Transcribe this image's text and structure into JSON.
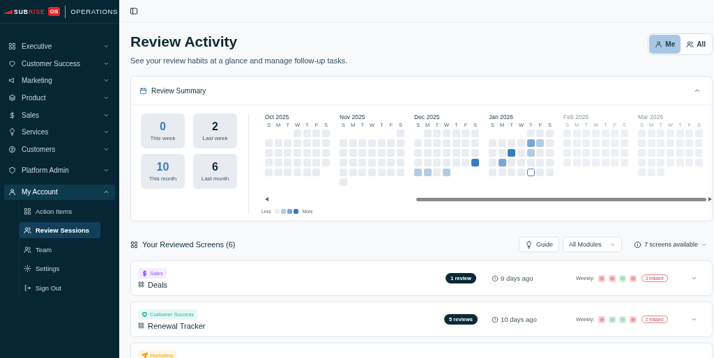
{
  "logo": {
    "lead": "SUB",
    "accent": "RISE",
    "badge": "OS",
    "product": "OPERATIONS"
  },
  "nav": [
    {
      "label": "Executive",
      "expanded": false
    },
    {
      "label": "Customer Success",
      "expanded": false
    },
    {
      "label": "Marketing",
      "expanded": false
    },
    {
      "label": "Product",
      "expanded": false
    },
    {
      "label": "Sales",
      "expanded": false
    },
    {
      "label": "Services",
      "expanded": false
    },
    {
      "label": "Customers",
      "expanded": false
    },
    {
      "label": "Platform Admin",
      "expanded": false
    },
    {
      "label": "My Account",
      "expanded": true,
      "children": [
        {
          "label": "Action Items",
          "selected": false
        },
        {
          "label": "Review Sessions",
          "selected": true
        },
        {
          "label": "Team",
          "selected": false
        },
        {
          "label": "Settings",
          "selected": false
        },
        {
          "label": "Sign Out",
          "selected": false
        }
      ]
    }
  ],
  "header": {
    "title": "Review Activity",
    "subtitle": "See your review habits at a glance and manage follow-up tasks."
  },
  "scope": [
    {
      "label": "Me",
      "selected": true
    },
    {
      "label": "All",
      "selected": false
    }
  ],
  "summary": {
    "title": "Review Summary",
    "expanded": true,
    "stats": [
      {
        "value": "0",
        "label": "This week",
        "highlight": true
      },
      {
        "value": "2",
        "label": "Last week",
        "highlight": false
      },
      {
        "value": "10",
        "label": "This month",
        "highlight": true
      },
      {
        "value": "6",
        "label": "Last month",
        "highlight": false
      }
    ],
    "months": [
      {
        "label": "Oct 2025",
        "faded": false,
        "weekdays": [
          "S",
          "M",
          "T",
          "W",
          "T",
          "F",
          "S"
        ],
        "weeks": [
          [
            {
              "kind": "none",
              "today": false
            },
            {
              "kind": "none",
              "today": false
            },
            {
              "kind": "none",
              "today": false
            },
            {
              "kind": "none",
              "today": false
            }
          ],
          [
            {
              "kind": "none",
              "today": false
            },
            {
              "kind": "none",
              "today": false
            },
            {
              "kind": "none",
              "today": false
            },
            {
              "kind": "none",
              "today": false
            },
            {
              "kind": "none",
              "today": false
            },
            {
              "kind": "none",
              "today": false
            },
            {
              "kind": "none",
              "today": false
            }
          ],
          [
            {
              "kind": "none",
              "today": false
            },
            {
              "kind": "none",
              "today": false
            },
            {
              "kind": "none",
              "today": false
            },
            {
              "kind": "none",
              "today": false
            },
            {
              "kind": "none",
              "today": false
            },
            {
              "kind": "none",
              "today": false
            },
            {
              "kind": "none",
              "today": false
            }
          ],
          [
            {
              "kind": "none",
              "today": false
            },
            {
              "kind": "none",
              "today": false
            },
            {
              "kind": "none",
              "today": false
            },
            {
              "kind": "none",
              "today": false
            },
            {
              "kind": "none",
              "today": false
            },
            {
              "kind": "none",
              "today": false
            },
            {
              "kind": "none",
              "today": false
            }
          ],
          [
            {
              "kind": "none",
              "today": false
            },
            {
              "kind": "none",
              "today": false
            },
            {
              "kind": "none",
              "today": false
            },
            {
              "kind": "none",
              "today": false
            },
            {
              "kind": "none",
              "today": false
            },
            {
              "kind": "none",
              "today": false
            }
          ]
        ]
      },
      {
        "label": "Nov 2025",
        "faded": false,
        "weekdays": [
          "S",
          "M",
          "T",
          "W",
          "T",
          "F",
          "S"
        ],
        "weeks": [
          [
            {
              "kind": "none",
              "today": false
            }
          ],
          [
            {
              "kind": "none",
              "today": false
            },
            {
              "kind": "none",
              "today": false
            },
            {
              "kind": "none",
              "today": false
            },
            {
              "kind": "none",
              "today": false
            },
            {
              "kind": "none",
              "today": false
            },
            {
              "kind": "none",
              "today": false
            },
            {
              "kind": "none",
              "today": false
            }
          ],
          [
            {
              "kind": "none",
              "today": false
            },
            {
              "kind": "none",
              "today": false
            },
            {
              "kind": "none",
              "today": false
            },
            {
              "kind": "none",
              "today": false
            },
            {
              "kind": "none",
              "today": false
            },
            {
              "kind": "none",
              "today": false
            },
            {
              "kind": "none",
              "today": false
            }
          ],
          [
            {
              "kind": "none",
              "today": false
            },
            {
              "kind": "none",
              "today": false
            },
            {
              "kind": "none",
              "today": false
            },
            {
              "kind": "none",
              "today": false
            },
            {
              "kind": "none",
              "today": false
            },
            {
              "kind": "none",
              "today": false
            },
            {
              "kind": "none",
              "today": false
            }
          ],
          [
            {
              "kind": "none",
              "today": false
            },
            {
              "kind": "none",
              "today": false
            },
            {
              "kind": "none",
              "today": false
            },
            {
              "kind": "none",
              "today": false
            },
            {
              "kind": "none",
              "today": false
            },
            {
              "kind": "none",
              "today": false
            },
            {
              "kind": "none",
              "today": false
            }
          ],
          [
            {
              "kind": "none",
              "today": false
            }
          ]
        ]
      },
      {
        "label": "Dec 2025",
        "faded": false,
        "weekdays": [
          "S",
          "M",
          "T",
          "W",
          "T",
          "F",
          "S"
        ],
        "weeks": [
          [
            {
              "kind": "none",
              "today": false
            },
            {
              "kind": "none",
              "today": false
            },
            {
              "kind": "none",
              "today": false
            },
            {
              "kind": "none",
              "today": false
            },
            {
              "kind": "none",
              "today": false
            },
            {
              "kind": "none",
              "today": false
            }
          ],
          [
            {
              "kind": "none",
              "today": false
            },
            {
              "kind": "none",
              "today": false
            },
            {
              "kind": "none",
              "today": false
            },
            {
              "kind": "none",
              "today": false
            },
            {
              "kind": "none",
              "today": false
            },
            {
              "kind": "none",
              "today": false
            },
            {
              "kind": "none",
              "today": false
            }
          ],
          [
            {
              "kind": "none",
              "today": false
            },
            {
              "kind": "none",
              "today": false
            },
            {
              "kind": "none",
              "today": false
            },
            {
              "kind": "none",
              "today": false
            },
            {
              "kind": "none",
              "today": false
            },
            {
              "kind": "none",
              "today": false
            },
            {
              "kind": "none",
              "today": false
            }
          ],
          [
            {
              "kind": "none",
              "today": false
            },
            {
              "kind": "none",
              "today": false
            },
            {
              "kind": "none",
              "today": false
            },
            {
              "kind": "none",
              "today": false
            },
            {
              "kind": "none",
              "today": false
            },
            {
              "kind": "none",
              "today": false
            },
            {
              "kind": "high",
              "today": false
            }
          ],
          [
            {
              "kind": "low",
              "today": false
            },
            {
              "kind": "low",
              "today": false
            },
            {
              "kind": "none",
              "today": false
            },
            {
              "kind": "low",
              "today": false
            }
          ]
        ]
      },
      {
        "label": "Jan 2026",
        "faded": false,
        "weekdays": [
          "S",
          "M",
          "T",
          "W",
          "T",
          "F",
          "S"
        ],
        "weeks": [
          [
            {
              "kind": "none",
              "today": false
            },
            {
              "kind": "none",
              "today": false
            },
            {
              "kind": "none",
              "today": false
            }
          ],
          [
            {
              "kind": "none",
              "today": false
            },
            {
              "kind": "none",
              "today": false
            },
            {
              "kind": "none",
              "today": false
            },
            {
              "kind": "none",
              "today": false
            },
            {
              "kind": "mid",
              "today": false
            },
            {
              "kind": "low",
              "today": false
            },
            {
              "kind": "none",
              "today": false
            }
          ],
          [
            {
              "kind": "none",
              "today": false
            },
            {
              "kind": "none",
              "today": false
            },
            {
              "kind": "high",
              "today": false
            },
            {
              "kind": "none",
              "today": false
            },
            {
              "kind": "low",
              "today": false
            },
            {
              "kind": "none",
              "today": false
            },
            {
              "kind": "none",
              "today": false
            }
          ],
          [
            {
              "kind": "none",
              "today": false
            },
            {
              "kind": "mid",
              "today": false
            },
            {
              "kind": "none",
              "today": false
            },
            {
              "kind": "none",
              "today": false
            },
            {
              "kind": "none",
              "today": false
            },
            {
              "kind": "none",
              "today": false
            },
            {
              "kind": "none",
              "today": false
            }
          ],
          [
            {
              "kind": "none",
              "today": false
            },
            {
              "kind": "none",
              "today": false
            },
            {
              "kind": "none",
              "today": false
            },
            {
              "kind": "none",
              "today": false
            },
            {
              "kind": "none",
              "today": true
            },
            {
              "kind": "none",
              "today": false
            },
            {
              "kind": "none",
              "today": false
            }
          ]
        ]
      },
      {
        "label": "Feb 2026",
        "faded": true,
        "weekdays": [
          "S",
          "M",
          "T",
          "W",
          "T",
          "F",
          "S"
        ],
        "weeks": [
          [
            {
              "kind": "none",
              "today": false
            },
            {
              "kind": "none",
              "today": false
            },
            {
              "kind": "none",
              "today": false
            },
            {
              "kind": "none",
              "today": false
            },
            {
              "kind": "none",
              "today": false
            },
            {
              "kind": "none",
              "today": false
            },
            {
              "kind": "none",
              "today": false
            }
          ],
          [
            {
              "kind": "none",
              "today": false
            },
            {
              "kind": "none",
              "today": false
            },
            {
              "kind": "none",
              "today": false
            },
            {
              "kind": "none",
              "today": false
            },
            {
              "kind": "none",
              "today": false
            },
            {
              "kind": "none",
              "today": false
            },
            {
              "kind": "none",
              "today": false
            }
          ],
          [
            {
              "kind": "none",
              "today": false
            },
            {
              "kind": "none",
              "today": false
            },
            {
              "kind": "none",
              "today": false
            },
            {
              "kind": "none",
              "today": false
            },
            {
              "kind": "none",
              "today": false
            },
            {
              "kind": "none",
              "today": false
            },
            {
              "kind": "none",
              "today": false
            }
          ],
          [
            {
              "kind": "none",
              "today": false
            },
            {
              "kind": "none",
              "today": false
            },
            {
              "kind": "none",
              "today": false
            },
            {
              "kind": "none",
              "today": false
            },
            {
              "kind": "none",
              "today": false
            },
            {
              "kind": "none",
              "today": false
            },
            {
              "kind": "none",
              "today": false
            }
          ]
        ]
      },
      {
        "label": "Mar 2026",
        "faded": true,
        "weekdays": [
          "S",
          "M",
          "T",
          "W",
          "T",
          "F",
          "S"
        ],
        "weeks": [
          [
            {
              "kind": "none",
              "today": false
            },
            {
              "kind": "none",
              "today": false
            },
            {
              "kind": "none",
              "today": false
            },
            {
              "kind": "none",
              "today": false
            },
            {
              "kind": "none",
              "today": false
            },
            {
              "kind": "none",
              "today": false
            },
            {
              "kind": "none",
              "today": false
            }
          ],
          [
            {
              "kind": "none",
              "today": false
            },
            {
              "kind": "none",
              "today": false
            },
            {
              "kind": "none",
              "today": false
            },
            {
              "kind": "none",
              "today": false
            },
            {
              "kind": "none",
              "today": false
            },
            {
              "kind": "none",
              "today": false
            },
            {
              "kind": "none",
              "today": false
            }
          ],
          [
            {
              "kind": "none",
              "today": false
            },
            {
              "kind": "none",
              "today": false
            },
            {
              "kind": "none",
              "today": false
            },
            {
              "kind": "none",
              "today": false
            },
            {
              "kind": "none",
              "today": false
            },
            {
              "kind": "none",
              "today": false
            },
            {
              "kind": "none",
              "today": false
            }
          ],
          [
            {
              "kind": "none",
              "today": false
            },
            {
              "kind": "none",
              "today": false
            },
            {
              "kind": "none",
              "today": false
            },
            {
              "kind": "none",
              "today": false
            },
            {
              "kind": "none",
              "today": false
            },
            {
              "kind": "none",
              "today": false
            },
            {
              "kind": "none",
              "today": false
            }
          ],
          [
            {
              "kind": "none",
              "today": false
            },
            {
              "kind": "none",
              "today": false
            },
            {
              "kind": "none",
              "today": false
            }
          ]
        ]
      }
    ],
    "legend": {
      "less": "Less",
      "steps": [
        {
          "kind": "none"
        },
        {
          "kind": "low"
        },
        {
          "kind": "mid"
        },
        {
          "kind": "high"
        }
      ],
      "more": "More"
    }
  },
  "screens": {
    "title": "Your Reviewed Screens (6)",
    "guide": "Guide",
    "module_filter": "All Modules",
    "available": "7 screens available",
    "items": [
      {
        "category": "Sales",
        "color": "#8b5cf6",
        "name": "Deals",
        "reviews": "1 review",
        "last": "9 days ago",
        "weekly_label": "Weekly:",
        "weekly": [
          {
            "ok": false
          },
          {
            "ok": false
          },
          {
            "ok": true
          },
          {
            "ok": false
          }
        ],
        "missed": "3 missed"
      },
      {
        "category": "Customer Success",
        "color": "#14b8a6",
        "name": "Renewal Tracker",
        "reviews": "5 reviews",
        "last": "10 days ago",
        "weekly_label": "Weekly:",
        "weekly": [
          {
            "ok": false
          },
          {
            "ok": true
          },
          {
            "ok": true
          },
          {
            "ok": false
          }
        ],
        "missed": "2 missed"
      },
      {
        "category": "Marketing",
        "color": "#f59e0b"
      }
    ]
  }
}
